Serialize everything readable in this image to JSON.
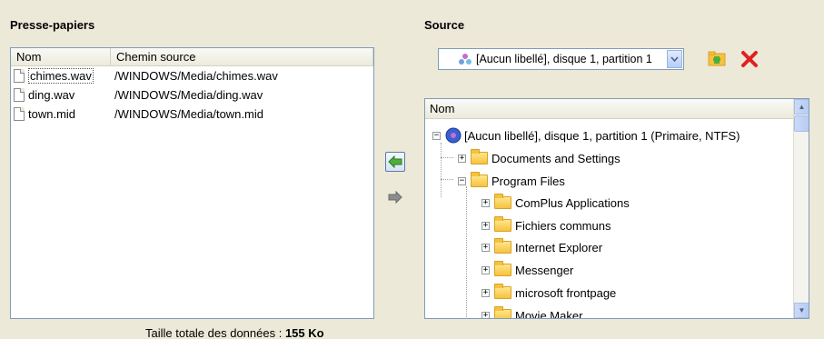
{
  "clipboard": {
    "title": "Presse-papiers",
    "columns": {
      "name": "Nom",
      "path": "Chemin source"
    },
    "files": [
      {
        "name": "chimes.wav",
        "path": "/WINDOWS/Media/chimes.wav"
      },
      {
        "name": "ding.wav",
        "path": "/WINDOWS/Media/ding.wav"
      },
      {
        "name": "town.mid",
        "path": "/WINDOWS/Media/town.mid"
      }
    ],
    "total_label": "Taille totale des données :",
    "total_value": "155 Ko"
  },
  "source": {
    "title": "Source",
    "selected": "[Aucun libellé], disque 1, partition 1",
    "tree_header": "Nom",
    "root": "[Aucun libellé], disque 1, partition 1 (Primaire, NTFS)",
    "level1": [
      "Documents and Settings",
      "Program Files"
    ],
    "program_files": [
      "ComPlus Applications",
      "Fichiers communs",
      "Internet Explorer",
      "Messenger",
      "microsoft frontpage",
      "Movie Maker"
    ]
  },
  "colors": {
    "background": "#ece9d8",
    "border": "#7f9db9",
    "folder": "#f6c23e",
    "arrow": "#4caf3d"
  }
}
